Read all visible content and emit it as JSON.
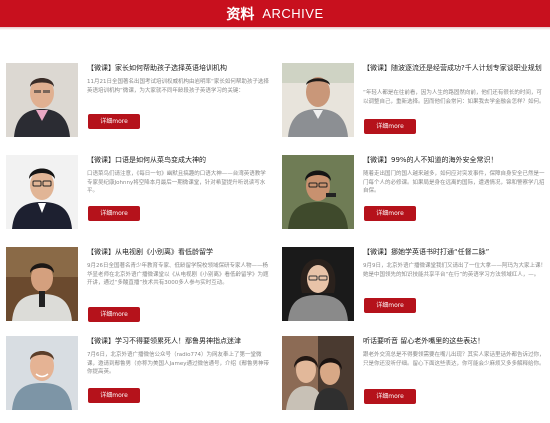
{
  "banner": {
    "title_zh": "资料",
    "title_en": "ARCHIVE"
  },
  "colors": {
    "accent": "#c8101e",
    "button": "#b5121b"
  },
  "cards": [
    {
      "title": "【微课】家长如何帮助孩子选择英语培训机构",
      "desc": "11月21日全国著名出国考试培训权威机构由岩明率“家长如何帮助孩子选择英语培训机构”微课，为大家就不同年龄段孩子英语学习的关键：",
      "more": "详细more"
    },
    {
      "title": "【微课】随波逐流还是经营成功?千人计划专家谈职业规划",
      "desc": "“年轻人都是在往前看，因为人生的路固然向前，他们还有很长的时间，可以调整自己，重新选择。因而他们会常问：如果我去学金融会怎样？如何。",
      "more": "详细more"
    },
    {
      "title": "【微课】口语是如何从菜鸟变成大神的",
      "desc": "口语菜鸟们请注意，《每日一句》幽默且搞趣的口语大神——台湾英语教学专家吴纪康Johnny将空降本月最后一期微课堂，针对希望提升听说读写水平。",
      "more": "详细more"
    },
    {
      "title": "【微课】99%的人不知道的海外安全常识！",
      "desc": "随着走出国门的国人越来越多，如何应对突发事件，保障自身安全已然是一门每个人的必修课。如果局是身在远离的国际，遭遇情况，锦和警察学几招自保。",
      "more": "详细more"
    },
    {
      "title": "【微课】从电视剧《小别离》看低龄留学",
      "desc": "9月26日全国著名青少年教育专家、低龄留学院校领域保研专家人物——杨华显老师在北京外语广播微课堂以《从电视剧《小别离》看低龄留学》为题开讲，通过“多酸直播”技术共有3000多人参与实时互动。",
      "more": "详细more"
    },
    {
      "title": "【微课】挪她学英语书时打通“任督二脉”",
      "desc": "9月9日，北京外语广播微课堂我们又请出了一位大拿——阿玛为大家上课！她是中国领先的知识技能共享平台“在行”的英语学习方法领域红人，—。",
      "more": "详细more"
    },
    {
      "title": "【微课】学习不得要领累死人！鄢鲁男神指点迷津",
      "desc": "7月6日，北京外语广播微信公众号（radio774）为网友奉上了第一堂微课，邀请到鄢鲁男（亦称为美国人Jamey通过微信通号，介绍《鄢鲁男神带你提高英。",
      "more": "详细more"
    },
    {
      "title": "听话要听音 留心老外嘴里的这些表达！",
      "desc": "跟老外交流总是不得要领需要在嘴儿出现？其实人家话里话外都告诉过你，只是你还没听仔细。留心下面这些表达，你可能会少麻烦又多多解释给你。",
      "more": "详细more"
    }
  ]
}
